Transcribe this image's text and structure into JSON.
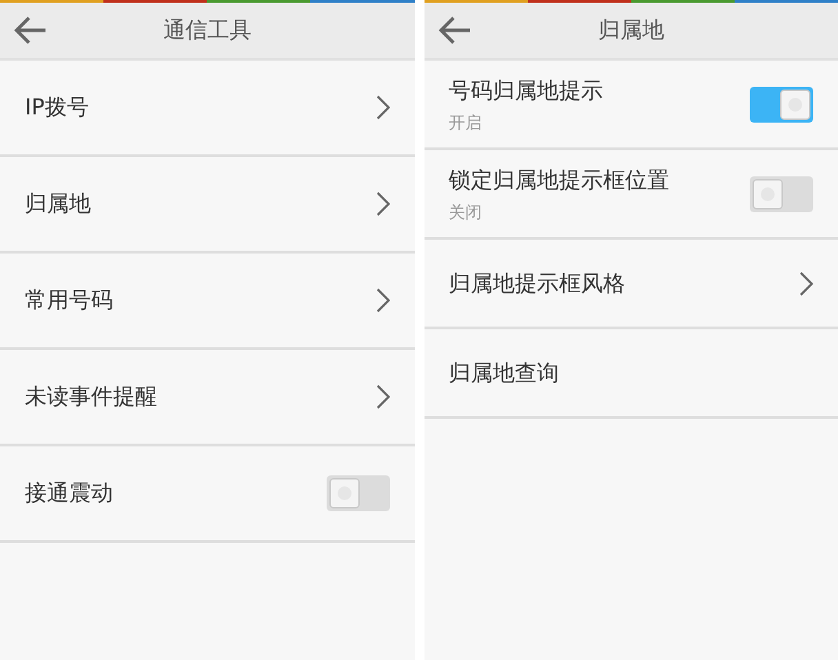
{
  "screens": [
    {
      "title": "通信工具",
      "items": [
        {
          "kind": "link",
          "label": "IP拨号"
        },
        {
          "kind": "link",
          "label": "归属地"
        },
        {
          "kind": "link",
          "label": "常用号码"
        },
        {
          "kind": "link",
          "label": "未读事件提醒"
        },
        {
          "kind": "toggle",
          "label": "接通震动",
          "on": false
        }
      ]
    },
    {
      "title": "归属地",
      "items": [
        {
          "kind": "toggle",
          "label": "号码归属地提示",
          "sublabel": "开启",
          "on": true
        },
        {
          "kind": "toggle",
          "label": "锁定归属地提示框位置",
          "sublabel": "关闭",
          "on": false
        },
        {
          "kind": "link",
          "label": "归属地提示框风格"
        },
        {
          "kind": "plain",
          "label": "归属地查询"
        }
      ]
    }
  ]
}
